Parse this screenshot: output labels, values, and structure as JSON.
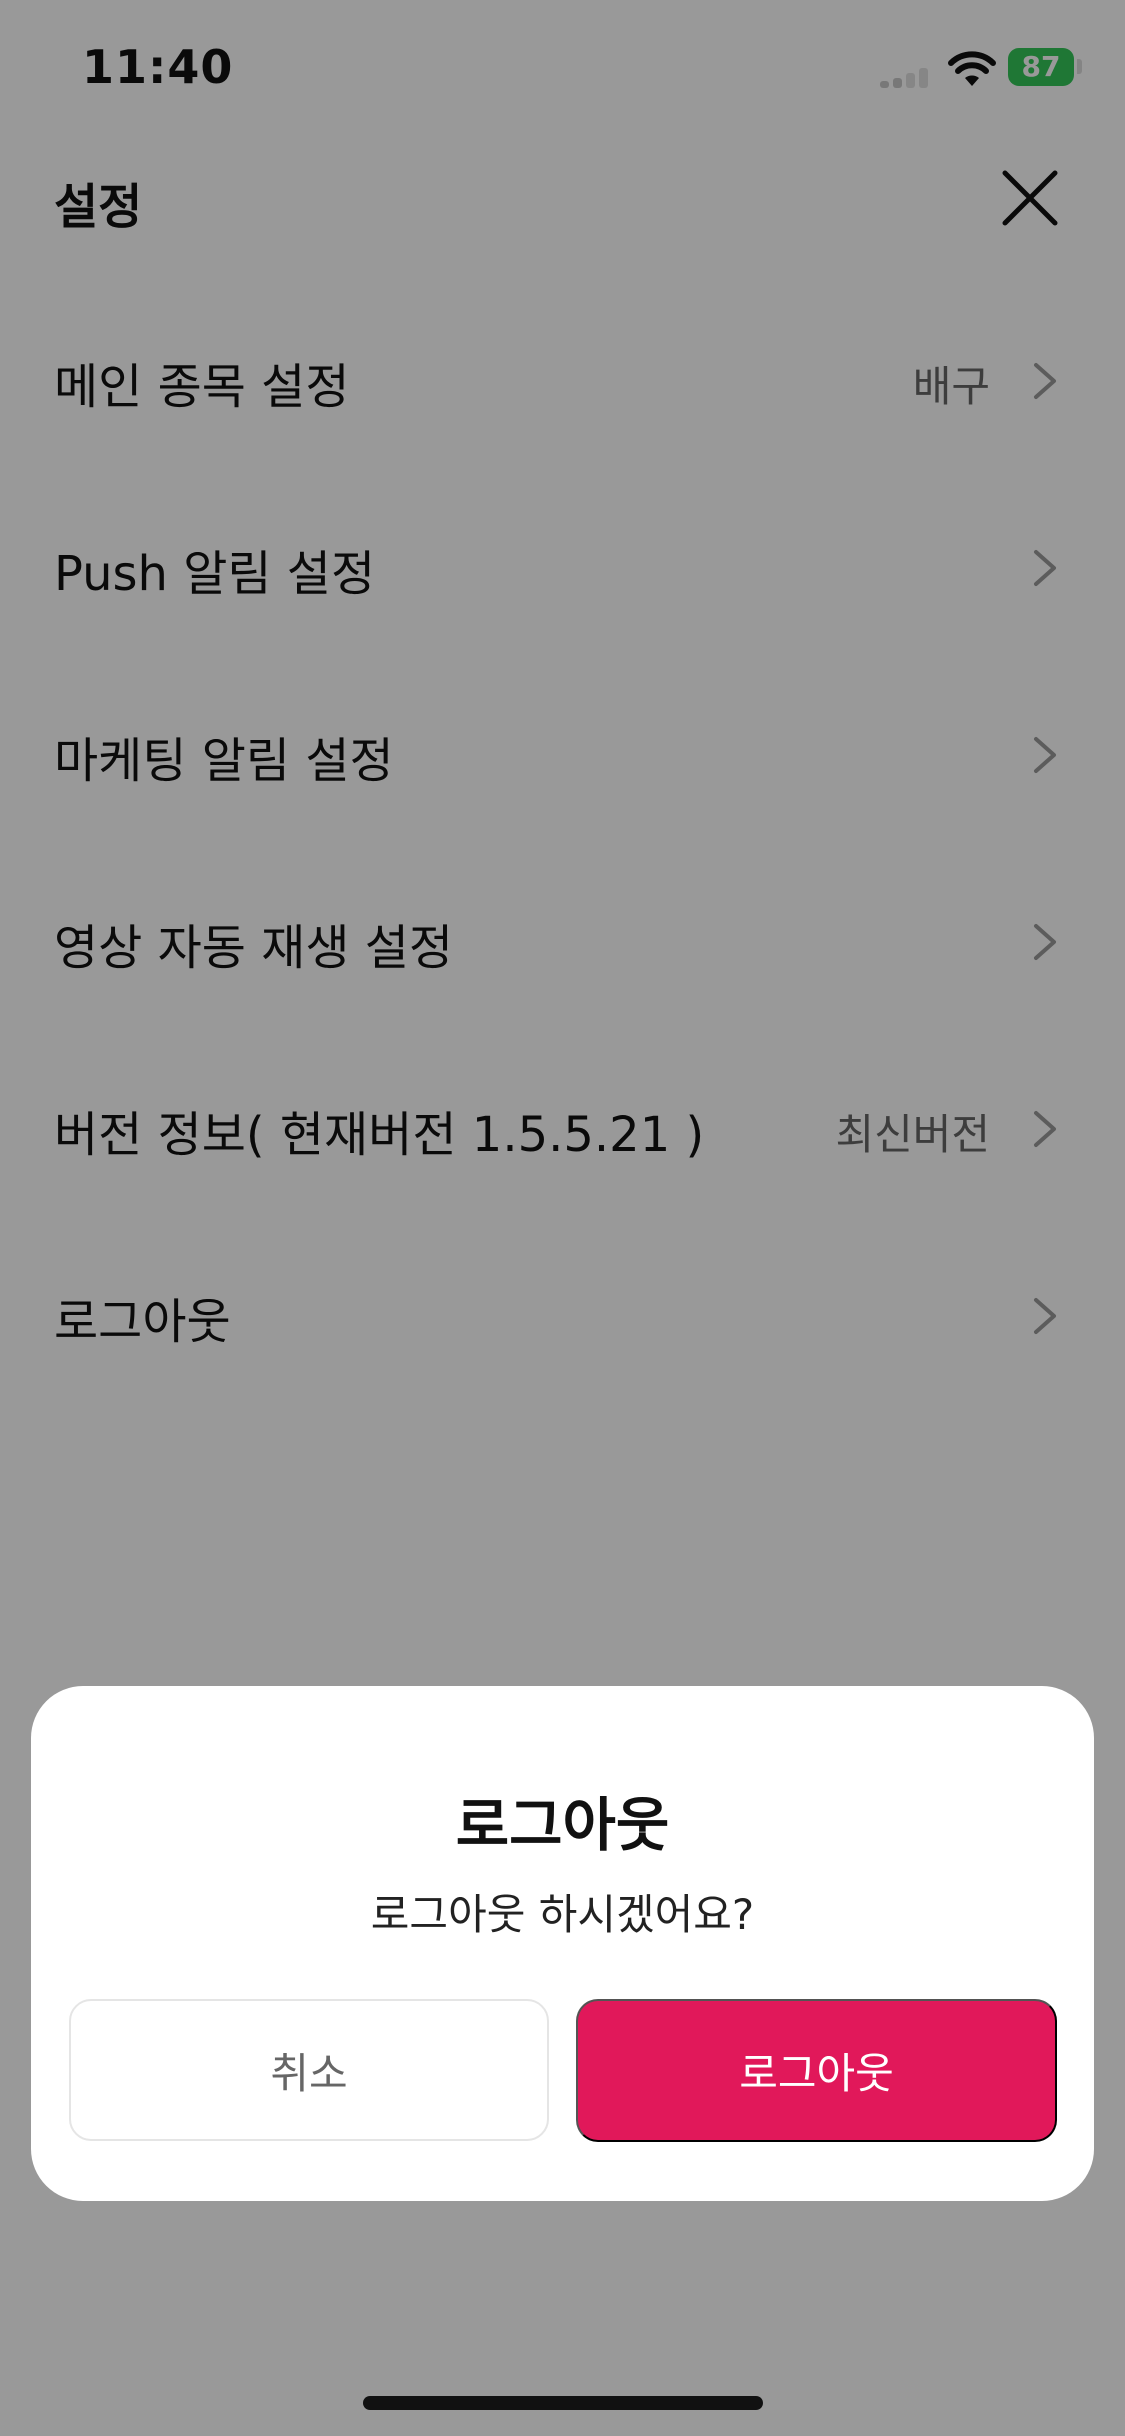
{
  "status_bar": {
    "time": "11:40",
    "battery": "87",
    "icons": [
      "signal-icon",
      "wifi-icon",
      "battery-icon"
    ]
  },
  "header": {
    "title": "설정",
    "close_icon": "close-icon"
  },
  "settings": [
    {
      "label": "메인 종목 설정",
      "value": "배구"
    },
    {
      "label": "Push 알림 설정",
      "value": ""
    },
    {
      "label": "마케팅 알림 설정",
      "value": ""
    },
    {
      "label": "영상 자동 재생 설정",
      "value": ""
    },
    {
      "label": "버전 정보( 현재버전 1.5.5.21 )",
      "value": "최신버전"
    },
    {
      "label": "로그아웃",
      "value": ""
    }
  ],
  "dialog": {
    "title": "로그아웃",
    "message": "로그아웃 하시겠어요?",
    "cancel_label": "취소",
    "confirm_label": "로그아웃"
  },
  "colors": {
    "accent": "#e1185a",
    "battery": "#34c759",
    "overlay": "rgba(0,0,0,0.4)"
  }
}
